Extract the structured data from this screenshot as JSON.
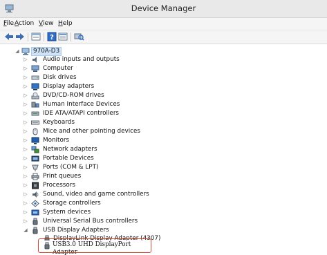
{
  "window": {
    "title": "Device Manager"
  },
  "menu": [
    {
      "label": "File",
      "accel": "F",
      "rest": "ile"
    },
    {
      "label": "Action",
      "accel": "A",
      "rest": "ction"
    },
    {
      "label": "View",
      "accel": "V",
      "rest": "iew"
    },
    {
      "label": "Help",
      "accel": "H",
      "rest": "elp"
    }
  ],
  "toolbar": [
    "back-arrow-icon",
    "forward-arrow-icon",
    "properties-icon",
    "help-icon",
    "view-icon",
    "scan-hardware-icon"
  ],
  "tree": {
    "root": {
      "label": "970A-D3",
      "expanded": true
    },
    "categories": [
      {
        "label": "Audio inputs and outputs",
        "icon": "speaker-icon"
      },
      {
        "label": "Computer",
        "icon": "computer-icon"
      },
      {
        "label": "Disk drives",
        "icon": "disk-drive-icon"
      },
      {
        "label": "Display adapters",
        "icon": "display-adapter-icon"
      },
      {
        "label": "DVD/CD-ROM drives",
        "icon": "dvd-drive-icon"
      },
      {
        "label": "Human Interface Devices",
        "icon": "hid-icon"
      },
      {
        "label": "IDE ATA/ATAPI controllers",
        "icon": "ide-controller-icon"
      },
      {
        "label": "Keyboards",
        "icon": "keyboard-icon"
      },
      {
        "label": "Mice and other pointing devices",
        "icon": "mouse-icon"
      },
      {
        "label": "Monitors",
        "icon": "monitor-icon"
      },
      {
        "label": "Network adapters",
        "icon": "network-adapter-icon"
      },
      {
        "label": "Portable Devices",
        "icon": "portable-device-icon"
      },
      {
        "label": "Ports (COM & LPT)",
        "icon": "port-icon"
      },
      {
        "label": "Print queues",
        "icon": "printer-icon"
      },
      {
        "label": "Processors",
        "icon": "processor-icon"
      },
      {
        "label": "Sound, video and game controllers",
        "icon": "sound-icon"
      },
      {
        "label": "Storage controllers",
        "icon": "storage-controller-icon"
      },
      {
        "label": "System devices",
        "icon": "system-device-icon"
      },
      {
        "label": "Universal Serial Bus controllers",
        "icon": "usb-icon"
      },
      {
        "label": "USB Display Adapters",
        "icon": "usb-icon",
        "expanded": true
      }
    ],
    "children": [
      {
        "label": "DisplayLink Display Adapter (4307)"
      },
      {
        "label": "USB3.0 UHD DisplayPort"
      },
      {
        "label": "Adapter"
      }
    ]
  },
  "colors": {
    "highlight": "#d24a2e",
    "selection": "#cfe3f8"
  }
}
